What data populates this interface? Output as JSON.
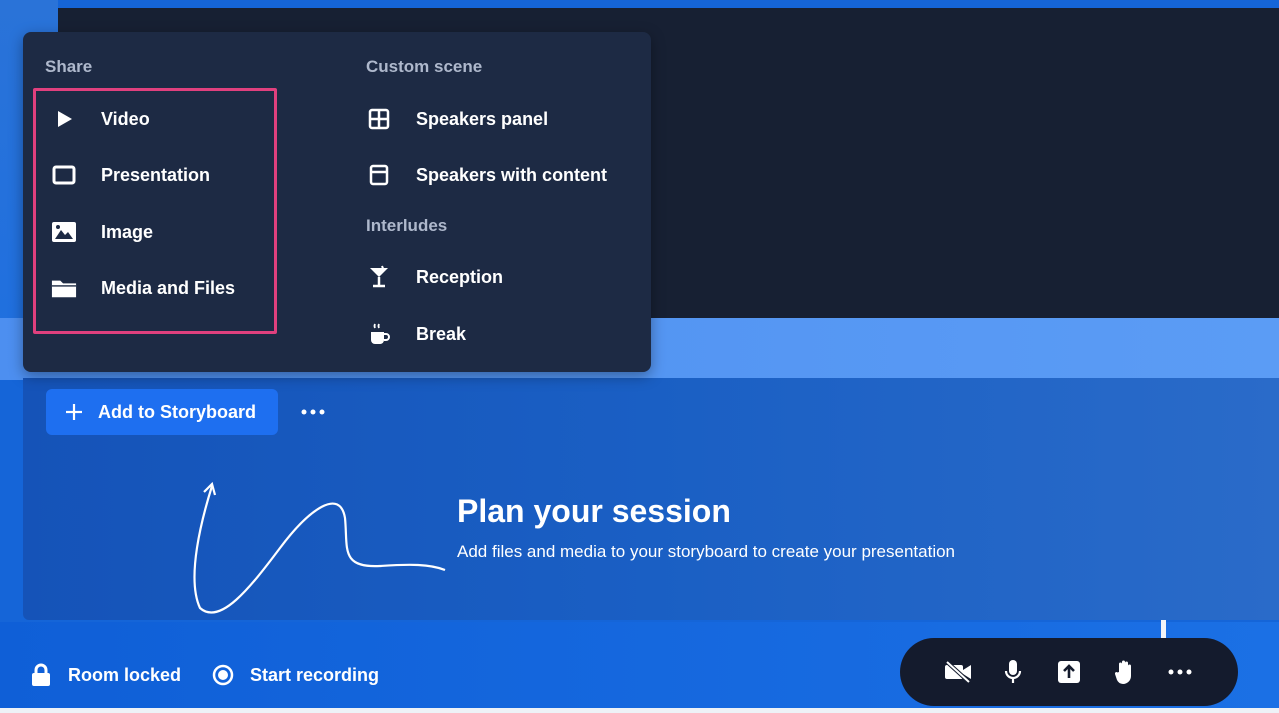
{
  "menu": {
    "share_label": "Share",
    "share_items": [
      {
        "label": "Video",
        "icon": "play-icon"
      },
      {
        "label": "Presentation",
        "icon": "presentation-icon"
      },
      {
        "label": "Image",
        "icon": "image-icon"
      },
      {
        "label": "Media and Files",
        "icon": "folder-icon"
      }
    ],
    "custom_scene_label": "Custom scene",
    "custom_scene_items": [
      {
        "label": "Speakers panel",
        "icon": "grid-icon"
      },
      {
        "label": "Speakers with content",
        "icon": "layout-icon"
      }
    ],
    "interludes_label": "Interludes",
    "interludes_items": [
      {
        "label": "Reception",
        "icon": "cocktail-icon"
      },
      {
        "label": "Break",
        "icon": "coffee-icon"
      }
    ]
  },
  "storyboard": {
    "add_label": "Add to Storyboard",
    "title": "Plan your session",
    "subtitle": "Add files and media to your storyboard to create your presentation"
  },
  "bottom": {
    "room_locked": "Room locked",
    "start_recording": "Start recording"
  },
  "colors": {
    "highlight": "#e0407e",
    "menu_bg": "#1d2a44",
    "accent": "#1e6ff0"
  }
}
